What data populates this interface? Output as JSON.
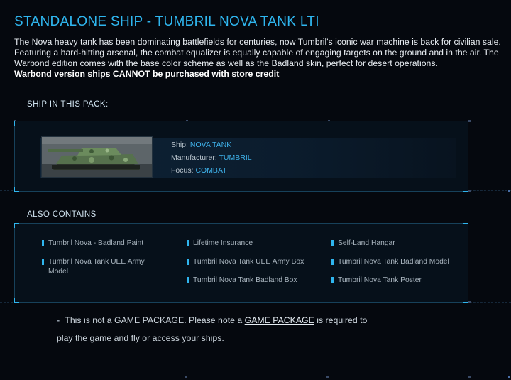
{
  "header": {
    "title": "STANDALONE SHIP - TUMBRIL NOVA TANK LTI",
    "description": "The Nova heavy tank has been dominating battlefields for centuries, now Tumbril's iconic war machine is back for civilian sale. Featuring a hard-hitting arsenal, the combat equalizer is equally capable of engaging targets on the ground and in the air. The Warbond edition comes with the base color scheme as well as the Badland skin, perfect for desert operations.",
    "warning": "Warbond version ships CANNOT be purchased with store credit"
  },
  "ship_section": {
    "label": "SHIP IN THIS PACK:",
    "ship": {
      "ship_label": "Ship:",
      "ship_value": "NOVA TANK",
      "manufacturer_label": "Manufacturer:",
      "manufacturer_value": "TUMBRIL",
      "focus_label": "Focus:",
      "focus_value": "COMBAT"
    }
  },
  "contains_section": {
    "label": "ALSO CONTAINS",
    "items": [
      "Tumbril Nova - Badland Paint",
      "Lifetime Insurance",
      "Self-Land Hangar",
      "Tumbril Nova Tank UEE Army Model",
      "Tumbril Nova Tank UEE Army Box",
      "Tumbril Nova Tank Badland Model",
      "Tumbril Nova Tank Badland Box",
      "Tumbril Nova Tank Poster"
    ]
  },
  "note": {
    "dash": "-",
    "before": "This is not a GAME PACKAGE. Please note a ",
    "link": "GAME PACKAGE",
    "after": " is required to play the game and fly or access your ships."
  },
  "colors": {
    "accent": "#2fb6ef",
    "background": "#05080e",
    "panel_border": "#17415a"
  }
}
